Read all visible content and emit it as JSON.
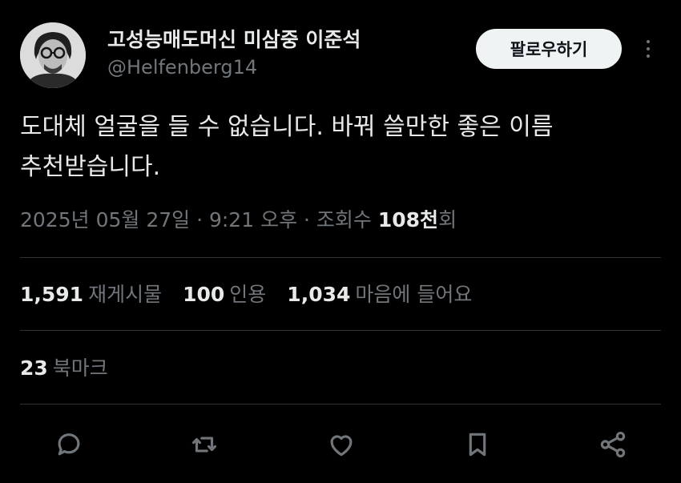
{
  "author": {
    "display_name": "고성능매도머신 미삼중 이준석",
    "handle": "@Helfenberg14"
  },
  "follow_button": {
    "label": "팔로우하기"
  },
  "tweet": {
    "text_lines": [
      "도대체 얼굴을 들 수 없습니다. 바꿔 쓸만한 좋은 이름",
      "추천받습니다."
    ]
  },
  "meta": {
    "timestamp": "2025년 05월 27일 · 9:21 오후",
    "separator": " · ",
    "views_label": "조회수 ",
    "views_count": "108천",
    "views_suffix": "회"
  },
  "stats": {
    "reposts": {
      "count": "1,591",
      "label": "재게시물"
    },
    "quotes": {
      "count": "100",
      "label": "인용"
    },
    "likes": {
      "count": "1,034",
      "label": "마음에 들어요"
    },
    "bookmarks": {
      "count": "23",
      "label": "북마크"
    }
  },
  "actions": [
    "reply-icon",
    "repost-icon",
    "like-icon",
    "bookmark-icon",
    "share-icon"
  ],
  "colors": {
    "background": "#000000",
    "primary_text": "#e7e9ea",
    "secondary_text": "#71767b",
    "divider": "#2f3336",
    "follow_button_bg": "#eff3f4"
  }
}
